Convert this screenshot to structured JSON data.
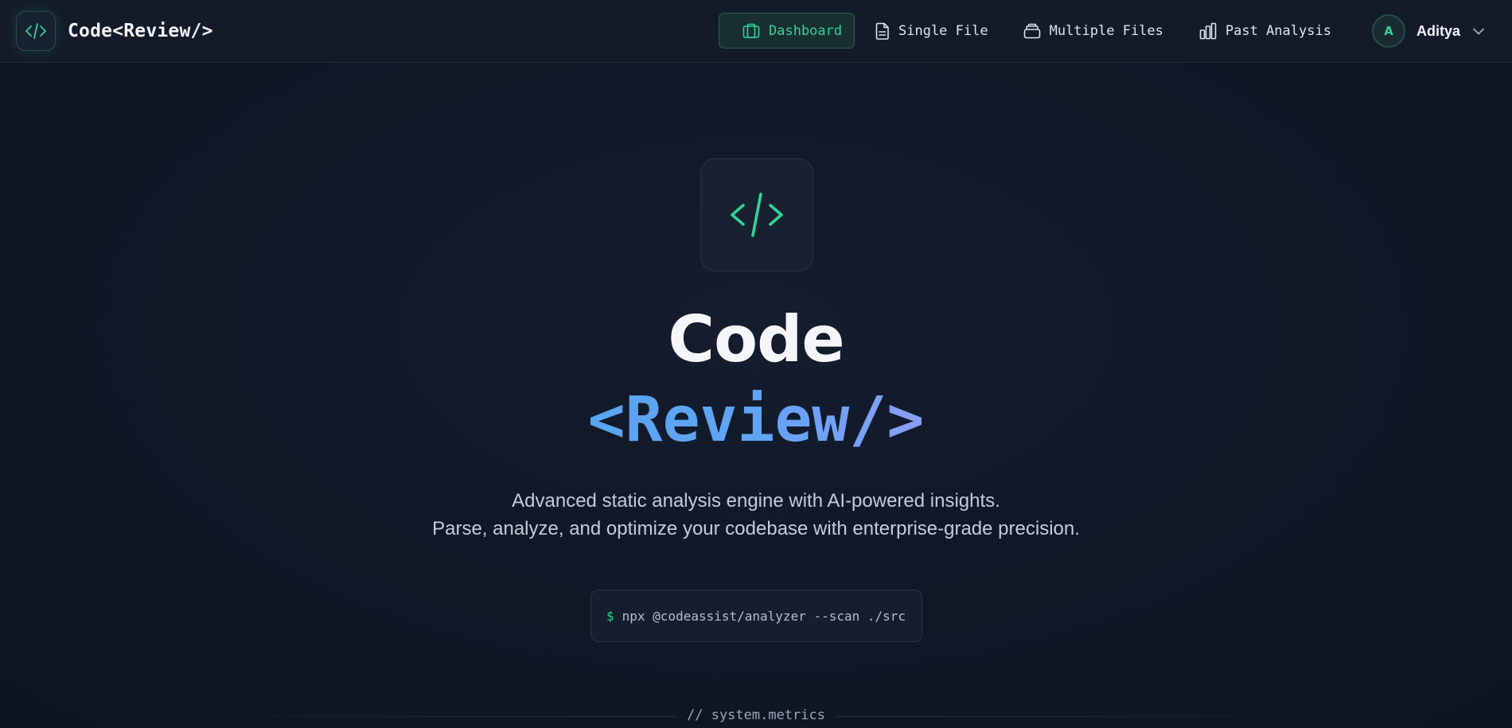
{
  "brand": {
    "name": "Code<Review/>",
    "logo_icon": "code-icon",
    "accent": "#34d399"
  },
  "nav": {
    "links": [
      {
        "label": "Dashboard",
        "icon": "dashboard-icon",
        "active": true
      },
      {
        "label": "Single File",
        "icon": "file-icon",
        "active": false
      },
      {
        "label": "Multiple Files",
        "icon": "files-stack-icon",
        "active": false
      },
      {
        "label": "Past Analysis",
        "icon": "bar-chart-icon",
        "active": false
      }
    ]
  },
  "user": {
    "initial": "A",
    "name": "Aditya"
  },
  "hero": {
    "icon": "code-icon",
    "title_line1": "Code",
    "title_line2": "<Review/>",
    "tagline_line1": "Advanced static analysis engine with AI-powered insights.",
    "tagline_line2": "Parse, analyze, and optimize your codebase with enterprise-grade precision.",
    "command_prompt": "$",
    "command": "npx @codeassist/analyzer --scan ./src"
  },
  "section": {
    "label": "// system.metrics"
  },
  "colors": {
    "background": "#0f1624",
    "accent_green": "#34d399",
    "accent_blue": "#60a5fa"
  }
}
